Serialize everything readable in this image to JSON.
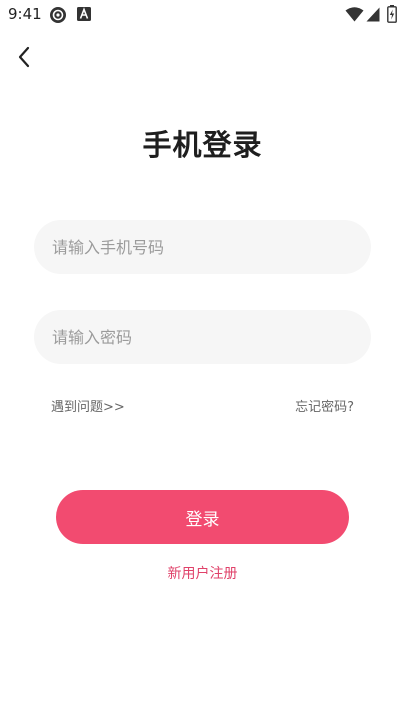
{
  "status_bar": {
    "time": "9:41",
    "icons_left": [
      "app-notification-icon",
      "a-letter-icon"
    ],
    "icons_right": [
      "wifi-icon",
      "cellular-signal-icon",
      "battery-icon"
    ]
  },
  "header": {
    "back_icon": "chevron-left-icon",
    "title": "手机登录"
  },
  "form": {
    "phone_placeholder": "请输入手机号码",
    "phone_value": "",
    "password_placeholder": "请输入密码",
    "password_value": ""
  },
  "links": {
    "problem": "遇到问题>>",
    "forgot_password": "忘记密码?"
  },
  "actions": {
    "login_label": "登录",
    "register_label": "新用户注册"
  },
  "colors": {
    "accent": "#f24b70",
    "link_accent": "#e0426a",
    "field_bg": "#f6f6f6"
  }
}
